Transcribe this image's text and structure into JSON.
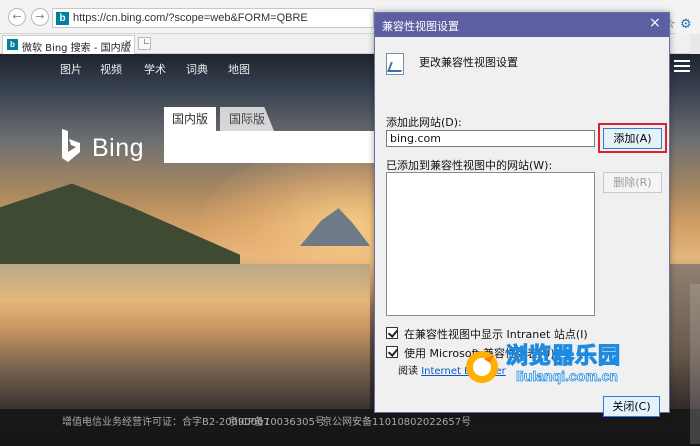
{
  "browser": {
    "url": "https://cn.bing.com/?scope=web&FORM=QBRE",
    "tab_title": "微软 Bing 搜索 - 国内版",
    "tab_close": "×",
    "back_icon": "back-arrow-icon",
    "forward_icon": "forward-arrow-icon"
  },
  "bing": {
    "nav": [
      "图片",
      "视频",
      "学术",
      "词典",
      "地图"
    ],
    "logo_text": "Bing",
    "search_tabs": [
      "国内版",
      "国际版"
    ],
    "footer": [
      "增值电信业务经营许可证：合字B2-20090007",
      "京ICP备10036305号",
      "京公网安备11010802022657号"
    ]
  },
  "dialog": {
    "title": "兼容性视图设置",
    "close": "×",
    "heading": "更改兼容性视图设置",
    "add_site_label": "添加此网站(D):",
    "site_value": "bing.com",
    "add_button": "添加(A)",
    "list_label": "已添加到兼容性视图中的网站(W):",
    "remove_button": "删除(R)",
    "checkbox_intranet": "在兼容性视图中显示 Intranet 站点(I)",
    "checkbox_ms_list": "使用 Microsoft 兼容性列表(U)",
    "read_prefix": "阅读",
    "read_link": "Internet Explorer",
    "close_button": "关闭(C)"
  },
  "watermark": {
    "cn": "浏览器乐园",
    "en": "liulanqi.com.cn"
  },
  "colors": {
    "titlebar": "#5d5fa3",
    "highlight": "#d9262e",
    "link": "#0b57c5"
  }
}
